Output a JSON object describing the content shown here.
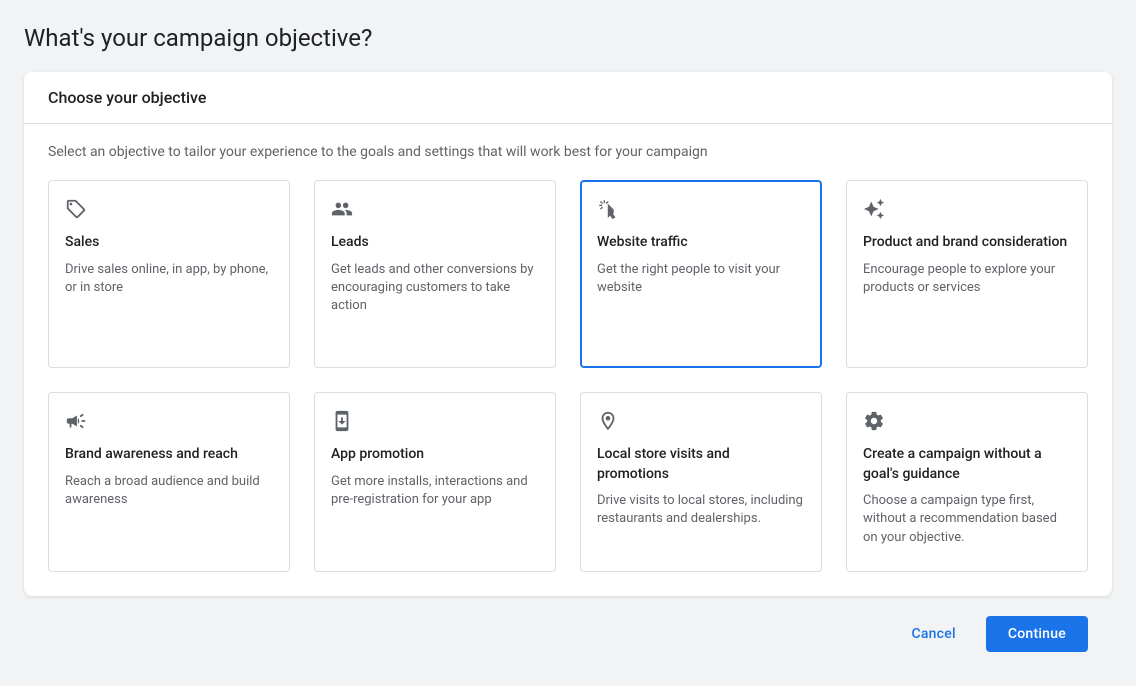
{
  "page": {
    "title": "What's your campaign objective?"
  },
  "section": {
    "header": "Choose your objective",
    "instruction": "Select an objective to tailor your experience to the goals and settings that will work best for your campaign"
  },
  "objectives": [
    {
      "title": "Sales",
      "desc": "Drive sales online, in app, by phone, or in store",
      "icon": "tag-icon",
      "selected": false
    },
    {
      "title": "Leads",
      "desc": "Get leads and other conversions by encouraging customers to take action",
      "icon": "people-icon",
      "selected": false
    },
    {
      "title": "Website traffic",
      "desc": "Get the right people to visit your website",
      "icon": "cursor-click-icon",
      "selected": true
    },
    {
      "title": "Product and brand consideration",
      "desc": "Encourage people to explore your products or services",
      "icon": "sparkle-icon",
      "selected": false
    },
    {
      "title": "Brand awareness and reach",
      "desc": "Reach a broad audience and build awareness",
      "icon": "megaphone-icon",
      "selected": false
    },
    {
      "title": "App promotion",
      "desc": "Get more installs, interactions and pre-registration for your app",
      "icon": "app-install-icon",
      "selected": false
    },
    {
      "title": "Local store visits and promotions",
      "desc": "Drive visits to local stores, including restaurants and dealerships.",
      "icon": "location-pin-icon",
      "selected": false
    },
    {
      "title": "Create a campaign without a goal's guidance",
      "desc": "Choose a campaign type first, without a recommendation based on your objective.",
      "icon": "gear-icon",
      "selected": false
    }
  ],
  "footer": {
    "cancel": "Cancel",
    "continue": "Continue"
  }
}
